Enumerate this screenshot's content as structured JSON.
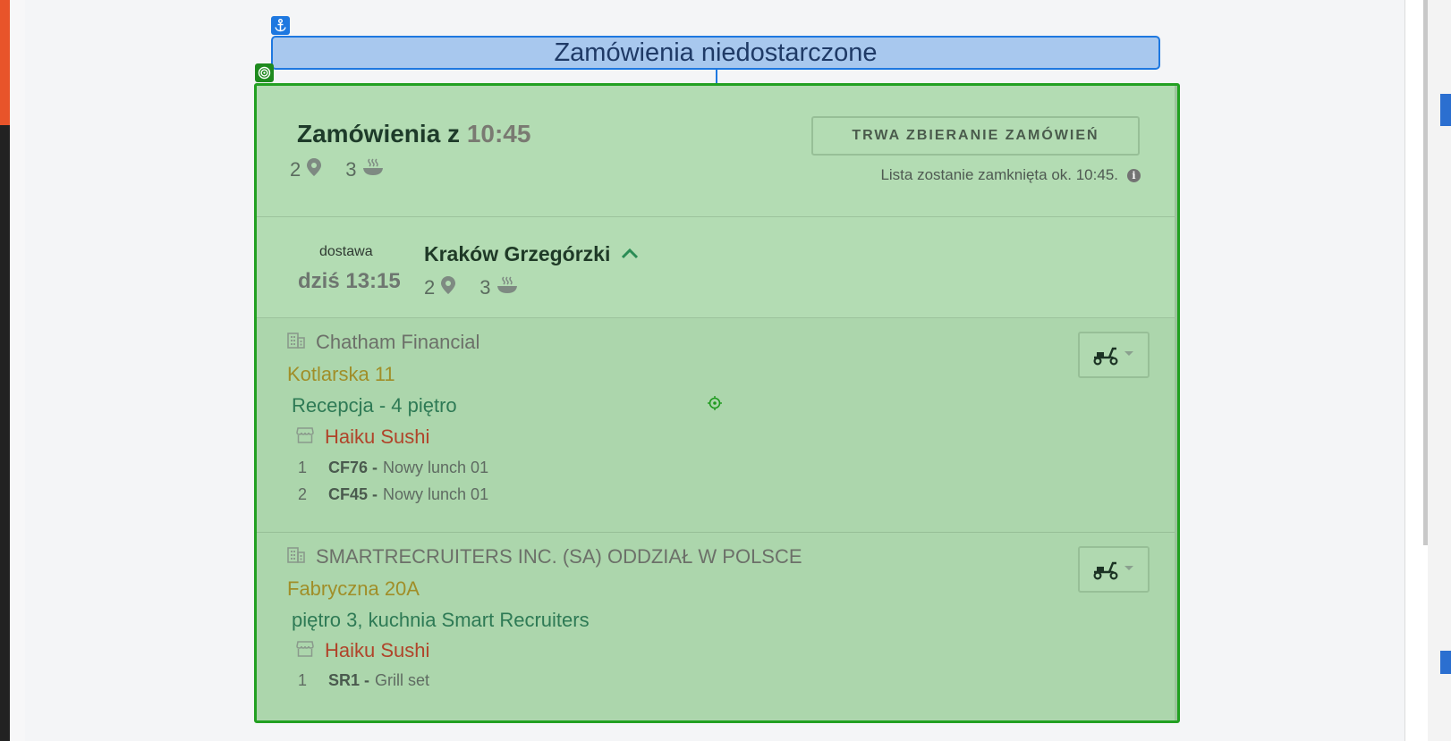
{
  "header": {
    "title": "Zamówienia niedostarczone"
  },
  "summary": {
    "title_prefix": "Zamówienia z",
    "time": "10:45",
    "locations_count": "2",
    "meals_count": "3",
    "status_button": "TRWA ZBIERANIE ZAMÓWIEŃ",
    "status_note": "Lista zostanie zamknięta ok. 10:45.",
    "info_glyph": "i"
  },
  "group": {
    "delivery_label": "dostawa",
    "delivery_time": "dziś 13:15",
    "name": "Kraków Grzegórzki",
    "locations_count": "2",
    "meals_count": "3"
  },
  "orders": [
    {
      "company": "Chatham Financial",
      "address": "Kotlarska 11",
      "place": "Recepcja - 4 piętro",
      "restaurant": "Haiku Sushi",
      "items": [
        {
          "qty": "1",
          "code": "CF76 -",
          "name": "Nowy lunch 01"
        },
        {
          "qty": "2",
          "code": "CF45 -",
          "name": "Nowy lunch 01"
        }
      ]
    },
    {
      "company": "SMARTRECRUITERS INC. (SA) ODDZIAŁ W POLSCE",
      "address": "Fabryczna 20A",
      "place": "piętro 3, kuchnia Smart Recruiters",
      "restaurant": "Haiku Sushi",
      "items": [
        {
          "qty": "1",
          "code": "SR1 -",
          "name": "Grill set"
        }
      ]
    }
  ],
  "icons": {
    "anchor": "anchor-icon",
    "target": "target-icon",
    "pin": "map-pin-icon",
    "bowl": "bowl-icon",
    "building": "building-icon",
    "store": "store-icon",
    "scooter": "scooter-icon",
    "chevron": "chevron-up-icon"
  },
  "colors": {
    "card_bg": "#acd6ac",
    "card_border": "#22a022",
    "header_bg": "#a8c8ee",
    "header_border": "#1e78e0",
    "address": "#a08e28",
    "restaurant": "#b0442a",
    "place": "#2e7a55"
  }
}
